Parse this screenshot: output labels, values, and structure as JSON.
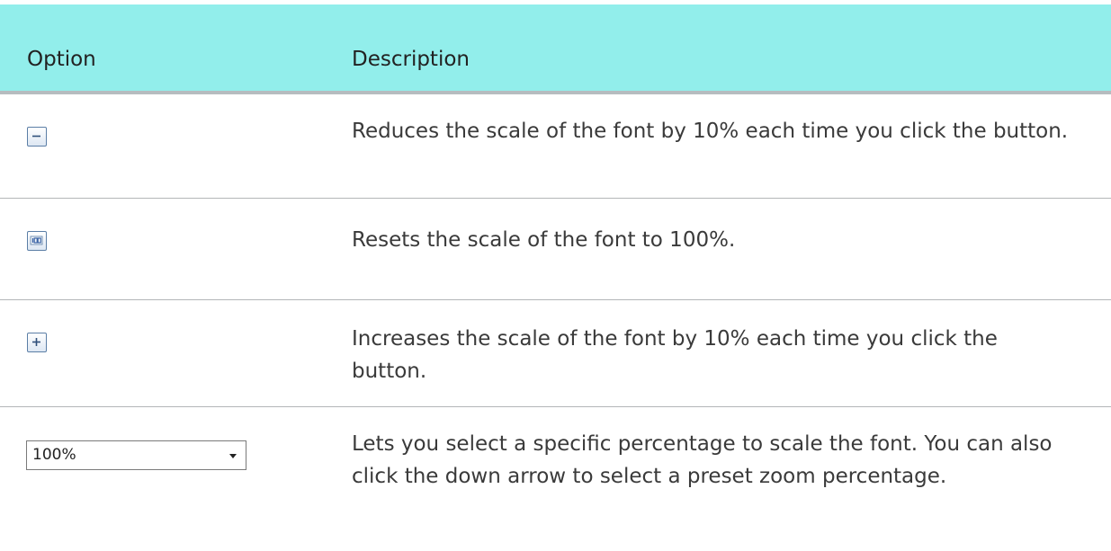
{
  "table": {
    "headers": {
      "option": "Option",
      "description": "Description"
    },
    "rows": [
      {
        "icon": "zoom-out-icon",
        "description": "Reduces the scale of the font by 10% each time you click the button."
      },
      {
        "icon": "reset-zoom-icon",
        "description": "Resets the scale of the font to 100%."
      },
      {
        "icon": "zoom-in-icon",
        "description": "Increases the scale of the font by 10% each time you click the button."
      },
      {
        "control": "zoom-dropdown",
        "control_value": "100%",
        "description": "Lets you select a specific percentage to scale the font. You can also click the down arrow to select a preset zoom percentage."
      }
    ]
  },
  "colors": {
    "header_background": "#92eeeb",
    "icon_border": "#5b7ea6",
    "divider": "#b3b6b8"
  }
}
